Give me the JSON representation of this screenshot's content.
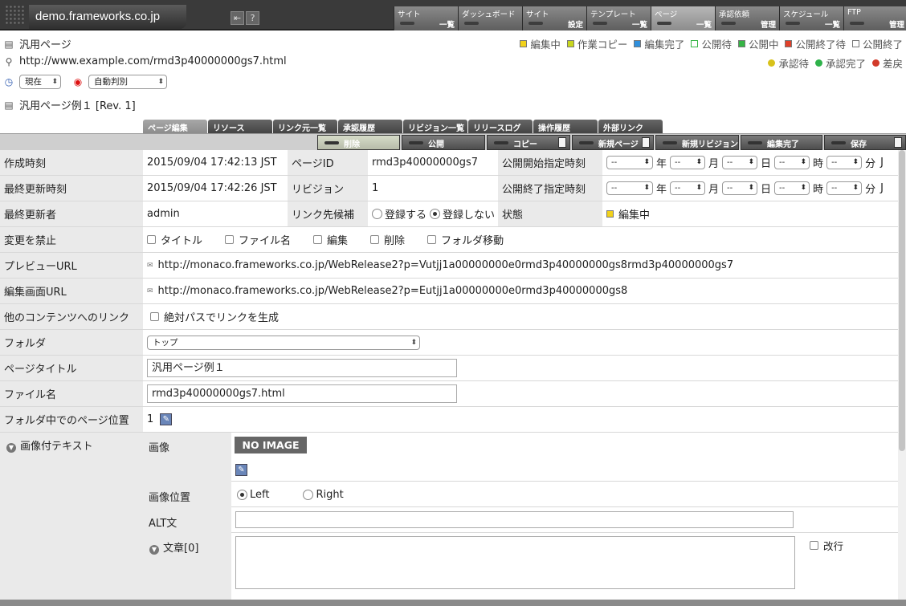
{
  "site": "demo.frameworks.co.jp",
  "nav": [
    {
      "t1": "サイト",
      "t2": "一覧"
    },
    {
      "t1": "ダッシュボード",
      "t2": ""
    },
    {
      "t1": "サイト",
      "t2": "設定"
    },
    {
      "t1": "テンプレート",
      "t2": "一覧"
    },
    {
      "t1": "ページ",
      "t2": "一覧"
    },
    {
      "t1": "承認依頼",
      "t2": "管理"
    },
    {
      "t1": "スケジュール",
      "t2": "一覧"
    },
    {
      "t1": "FTP",
      "t2": "管理"
    }
  ],
  "header": {
    "page_type": "汎用ページ",
    "url": "http://www.example.com/rmd3p40000000gs7.html",
    "time_select": "現在",
    "judge_select": "自動判別",
    "page_name": "汎用ページ例１ [Rev. 1]"
  },
  "legend_status": [
    {
      "label": "編集中",
      "color": "#f2d21b"
    },
    {
      "label": "作業コピー",
      "color": "#c8d61e"
    },
    {
      "label": "編集完了",
      "color": "#2f8fdc"
    },
    {
      "label": "公開待",
      "color": "#ffffff"
    },
    {
      "label": "公開中",
      "color": "#35b545"
    },
    {
      "label": "公開終了待",
      "color": "#e0402a"
    },
    {
      "label": "公開終了",
      "color": "#ffffff"
    }
  ],
  "legend_approval": [
    {
      "label": "承認待",
      "color": "#d8c21a"
    },
    {
      "label": "承認完了",
      "color": "#2fb24a"
    },
    {
      "label": "差戻",
      "color": "#d23a2a"
    }
  ],
  "tabs": [
    "ページ編集",
    "リソース",
    "リンク元一覧",
    "承認履歴",
    "リビジョン一覧",
    "リリースログ",
    "操作履歴",
    "外部リンク"
  ],
  "actions": [
    "削除",
    "公開",
    "コピー",
    "新規ページ",
    "新規リビジョン",
    "編集完了",
    "保存"
  ],
  "form": {
    "created_label": "作成時刻",
    "created": "2015/09/04 17:42:13 JST",
    "pageid_label": "ページID",
    "pageid": "rmd3p40000000gs7",
    "pubstart_label": "公開開始指定時刻",
    "updated_label": "最終更新時刻",
    "updated": "2015/09/04 17:42:26 JST",
    "revision_label": "リビジョン",
    "revision": "1",
    "pubend_label": "公開終了指定時刻",
    "updater_label": "最終更新者",
    "updater": "admin",
    "linkcand_label": "リンク先候補",
    "link_register": "登録する",
    "link_noregister": "登録しない",
    "state_label": "状態",
    "state": "編集中",
    "lock_label": "変更を禁止",
    "lock_options": [
      "タイトル",
      "ファイル名",
      "編集",
      "削除",
      "フォルダ移動"
    ],
    "preview_label": "プレビューURL",
    "preview_url": "http://monaco.frameworks.co.jp/WebRelease2?p=Vutjj1a00000000e0rmd3p40000000gs8rmd3p40000000gs7",
    "editurl_label": "編集画面URL",
    "edit_url": "http://monaco.frameworks.co.jp/WebRelease2?p=Eutjj1a00000000e0rmd3p40000000gs8",
    "otherlink_label": "他のコンテンツへのリンク",
    "abs_path": "絶対パスでリンクを生成",
    "folder_label": "フォルダ",
    "folder": "トップ",
    "title_label": "ページタイトル",
    "title": "汎用ページ例１",
    "filename_label": "ファイル名",
    "filename": "rmd3p40000000gs7.html",
    "position_label": "フォルダ中でのページ位置",
    "position": "1",
    "imgtext_label": "画像付テキスト",
    "image_label": "画像",
    "no_image": "NO IMAGE",
    "imgpos_label": "画像位置",
    "left": "Left",
    "right": "Right",
    "alt_label": "ALT文",
    "text_label": "文章[0]",
    "newline": "改行"
  },
  "date_units": [
    "年",
    "月",
    "日",
    "時",
    "分"
  ],
  "dash": "--",
  "tz": "J"
}
